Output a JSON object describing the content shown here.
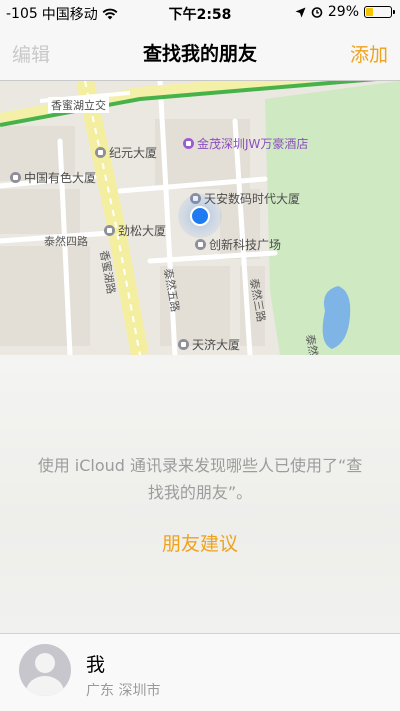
{
  "status_bar": {
    "signal": "-105",
    "carrier": "中国移动",
    "time": "下午2:58",
    "battery": "29%",
    "battery_level": 0.29
  },
  "nav": {
    "edit_label": "编辑",
    "title": "查找我的朋友",
    "add_label": "添加"
  },
  "map": {
    "labels": {
      "xiangmi_lijiao": "香蜜湖立交",
      "jinmao_hotel": "金茂深圳JW万豪酒店",
      "jiyuan_building": "纪元大厦",
      "china_nonferrous": "中国有色大厦",
      "tianan_digital": "天安数码时代大厦",
      "jinsong_building": "劲松大厦",
      "chuangxin_plaza": "创新科技广场",
      "tairan_4th_road": "泰然四路",
      "xiangmihu_road": "香蜜湖路",
      "tairan_5th_road": "泰然五路",
      "tairan_3rd_road": "泰然三路",
      "tianji_building": "天济大厦",
      "right_edge": "泰然"
    }
  },
  "content": {
    "message": "使用 iCloud 通讯录来发现哪些人已使用了“查找我的朋友”。",
    "suggest_label": "朋友建议"
  },
  "me": {
    "name": "我",
    "location": "广东 深圳市"
  },
  "colors": {
    "accent": "#f0a21d",
    "location_blue": "#1f7bf2",
    "park_green": "#cfe9c2"
  }
}
